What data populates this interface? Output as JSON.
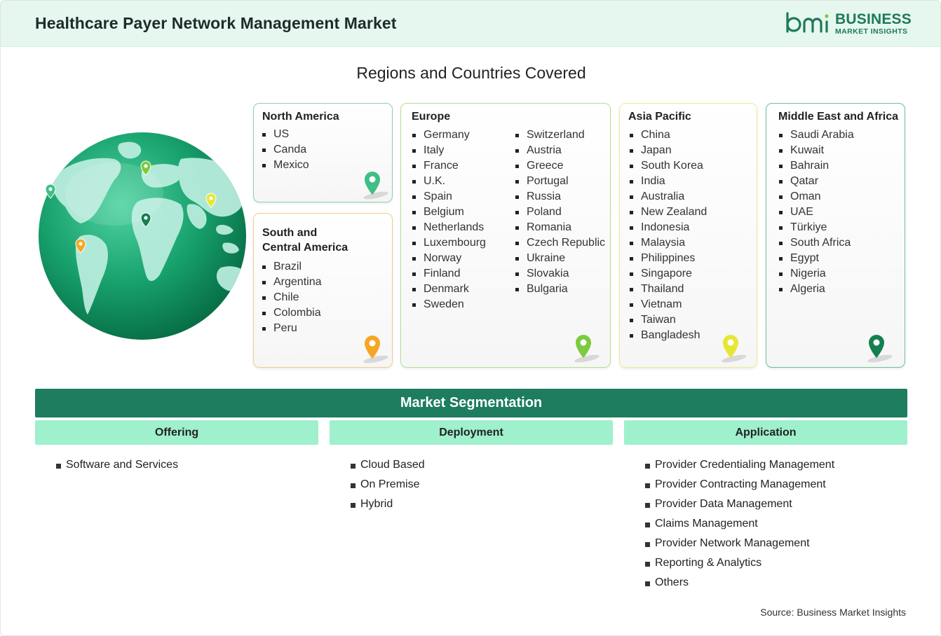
{
  "header": {
    "title": "Healthcare Payer Network Management Market",
    "logo_line1": "BUSINESS",
    "logo_line2": "MARKET INSIGHTS",
    "logo_mark": "bmi"
  },
  "regions": {
    "title": "Regions and Countries Covered",
    "north_america": {
      "title": "North America",
      "countries": [
        "US",
        "Canda",
        "Mexico"
      ],
      "pin_color": "#3dbf86"
    },
    "south_central_america": {
      "title_line1": "South and",
      "title_line2": "Central America",
      "countries": [
        "Brazil",
        "Argentina",
        "Chile",
        "Colombia",
        "Peru"
      ],
      "pin_color": "#f5a623"
    },
    "europe": {
      "title": "Europe",
      "countries_col1": [
        "Germany",
        "Italy",
        "France",
        "U.K.",
        "Spain",
        "Belgium",
        "Netherlands",
        "Luxembourg",
        "Norway",
        "Finland",
        "Denmark",
        "Sweden"
      ],
      "countries_col2": [
        "Switzerland",
        "Austria",
        "Greece",
        "Portugal",
        "Russia",
        "Poland",
        "Romania",
        "Czech Republic",
        "Ukraine",
        "Slovakia",
        "Bulgaria"
      ],
      "pin_color": "#7ccb3f"
    },
    "asia_pacific": {
      "title": "Asia Pacific",
      "countries": [
        "China",
        "Japan",
        "South Korea",
        "India",
        "Australia",
        "New Zealand",
        "Indonesia",
        "Malaysia",
        "Philippines",
        "Singapore",
        "Thailand",
        "Vietnam",
        "Taiwan",
        "Bangladesh"
      ],
      "pin_color": "#e8e635"
    },
    "middle_east_africa": {
      "title": "Middle East and Africa",
      "countries": [
        "Saudi Arabia",
        "Kuwait",
        "Bahrain",
        "Qatar",
        "Oman",
        "UAE",
        "Türkiye",
        "South Africa",
        "Egypt",
        "Nigeria",
        "Algeria"
      ],
      "pin_color": "#13804f"
    }
  },
  "segmentation": {
    "title": "Market Segmentation",
    "offering": {
      "header": "Offering",
      "items": [
        "Software and Services"
      ]
    },
    "deployment": {
      "header": "Deployment",
      "items": [
        "Cloud Based",
        "On Premise",
        "Hybrid"
      ]
    },
    "application": {
      "header": "Application",
      "items": [
        "Provider Credentialing Management",
        "Provider Contracting Management",
        "Provider Data Management",
        "Claims Management",
        "Provider Network Management",
        "Reporting & Analytics",
        "Others"
      ]
    }
  },
  "source": "Source: Business Market Insights",
  "colors": {
    "brand": "#1d7a56",
    "segment_bar": "#1d7d5e",
    "segment_header": "#9ff0cc",
    "header_bg": "#e6f7ef"
  },
  "icons": [
    "globe-icon",
    "map-pin-icon"
  ]
}
